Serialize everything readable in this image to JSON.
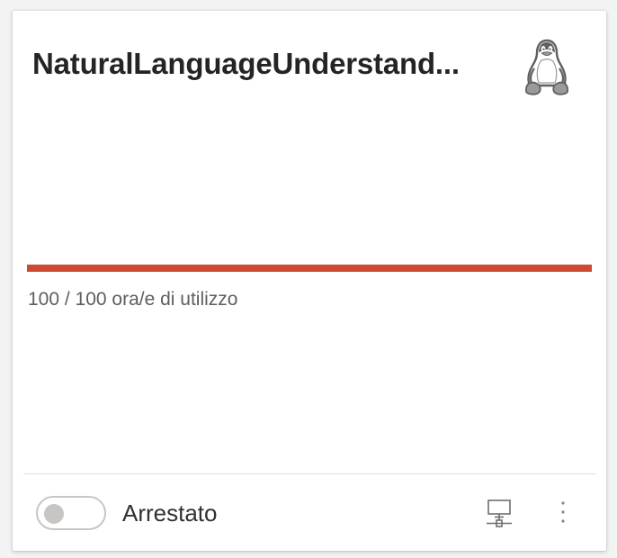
{
  "card": {
    "title": "NaturalLanguageUnderstand...",
    "os_icon": "linux-penguin-icon",
    "usage": {
      "used": 100,
      "total": 100,
      "fraction": 1.0,
      "text": "100 / 100 ora/e di utilizzo",
      "bar_color": "#cc4a31"
    },
    "toggle": {
      "state": "off"
    },
    "status_label": "Arrestato",
    "actions": {
      "connect_icon": "monitor-network-icon",
      "more_icon": "more-vertical-icon"
    }
  }
}
